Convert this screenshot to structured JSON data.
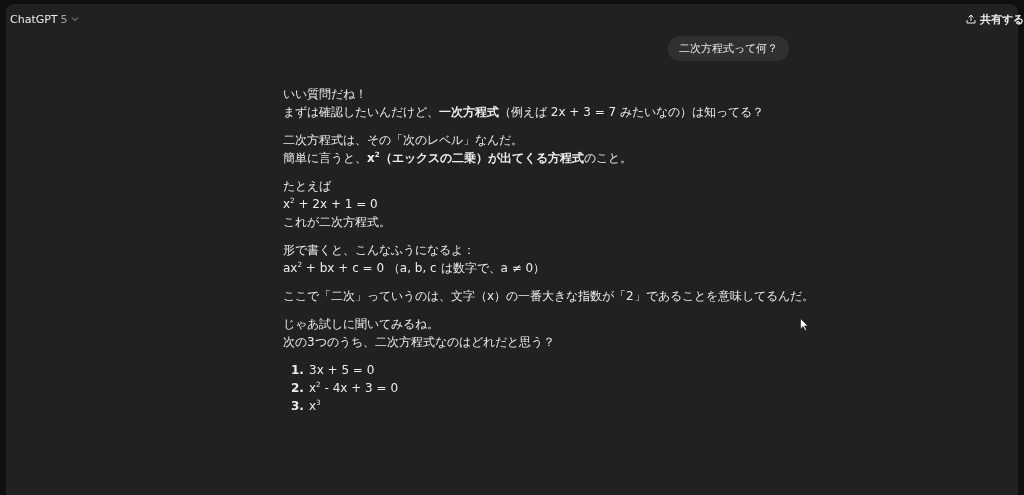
{
  "header": {
    "title": "ChatGPT",
    "version": "5",
    "share": "共有する"
  },
  "user_message": "二次方程式って何？",
  "paragraphs": [
    [
      "いい質問だね！",
      "まずは確認したいんだけど、**一次方程式**（例えば 2x + 3 = 7 みたいなの）は知ってる？"
    ],
    [
      "二次方程式は、その「次のレベル」なんだ。",
      "簡単に言うと、**x$^{2}$（エックスの二乗）が出てくる方程式**のこと。"
    ],
    [
      "たとえば",
      "x$^{2}$ + 2x + 1 = 0",
      "これが二次方程式。"
    ],
    [
      "形で書くと、こんなふうになるよ：",
      "ax$^{2}$ + bx + c = 0 （a, b, c は数字で、a ≠ 0）"
    ],
    [
      "ここで「二次」っていうのは、文字（x）の一番大きな指数が「2」であることを意味してるんだ。"
    ],
    [
      "じゃあ試しに聞いてみるね。",
      "次の3つのうち、二次方程式なのはどれだと思う？"
    ]
  ],
  "options": [
    {
      "number": "1.",
      "text": "3x + 5 = 0"
    },
    {
      "number": "2.",
      "text": "x$^{2}$ - 4x + 3 = 0"
    },
    {
      "number": "3.",
      "text": "x$^{3}$"
    }
  ]
}
